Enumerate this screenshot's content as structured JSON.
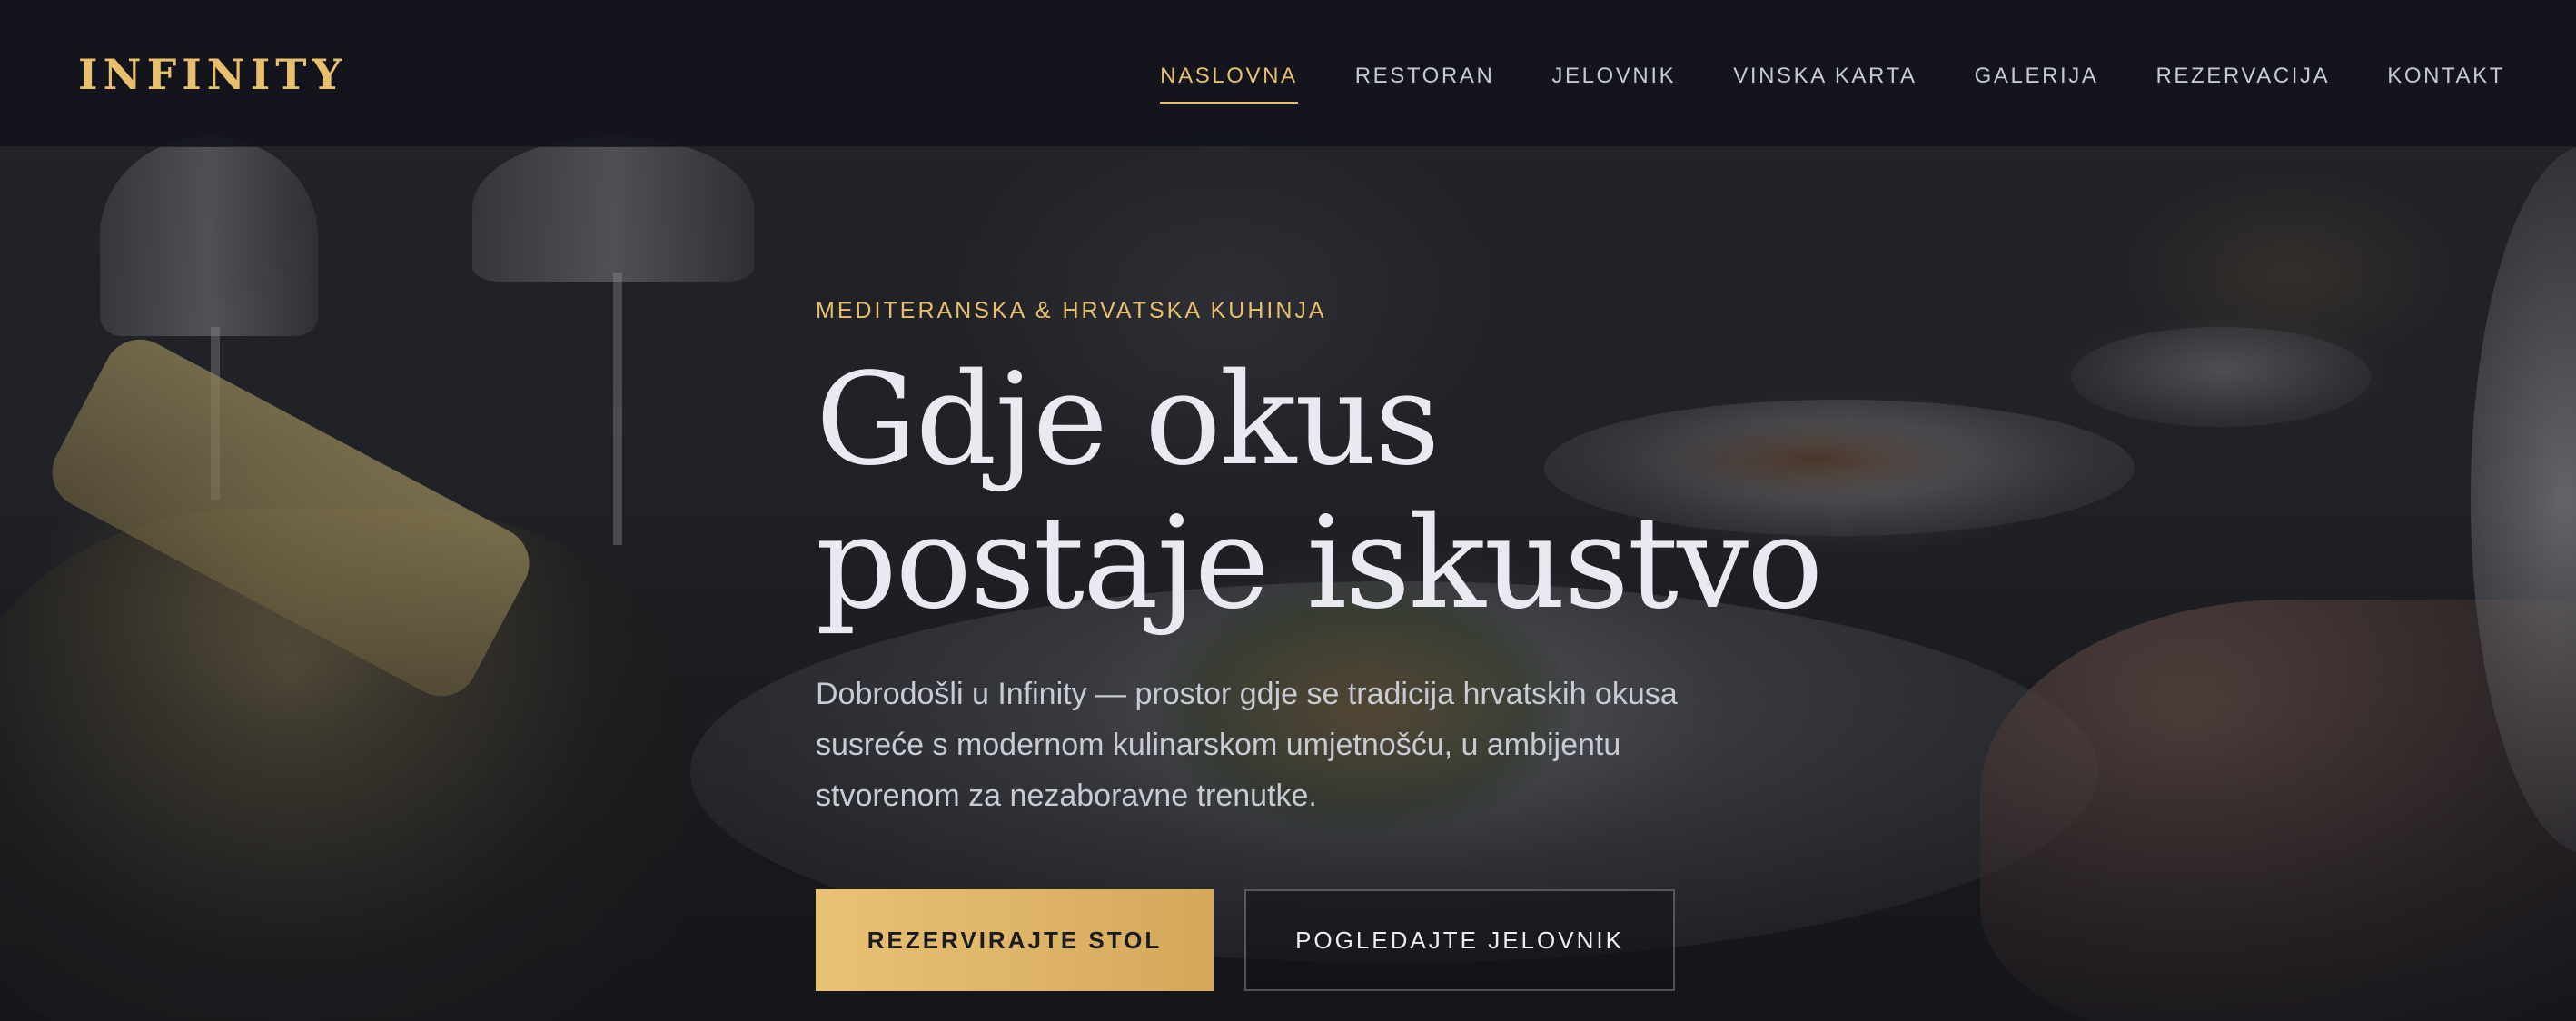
{
  "brand": {
    "logo_text": "INFINITY",
    "accent_color": "#e8bf6c",
    "background_color": "#14161d"
  },
  "nav": {
    "items": [
      {
        "label": "NASLOVNA",
        "active": true
      },
      {
        "label": "RESTORAN",
        "active": false
      },
      {
        "label": "JELOVNIK",
        "active": false
      },
      {
        "label": "VINSKA KARTA",
        "active": false
      },
      {
        "label": "GALERIJA",
        "active": false
      },
      {
        "label": "REZERVACIJA",
        "active": false
      },
      {
        "label": "KONTAKT",
        "active": false
      }
    ]
  },
  "hero": {
    "eyebrow": "MEDITERANSKA & HRVATSKA KUHINJA",
    "headline_line1": "Gdje okus",
    "headline_line2": "postaje iskustvo",
    "lead": "Dobrodošli u Infinity — prostor gdje se tradicija hrvatskih okusa susreće s modernom kulinarskom umjetnošću, u ambijentu stvorenom za nezaboravne trenutke.",
    "primary_button": "REZERVIRAJTE STOL",
    "secondary_button": "POGLEDAJTE JELOVNIK"
  }
}
